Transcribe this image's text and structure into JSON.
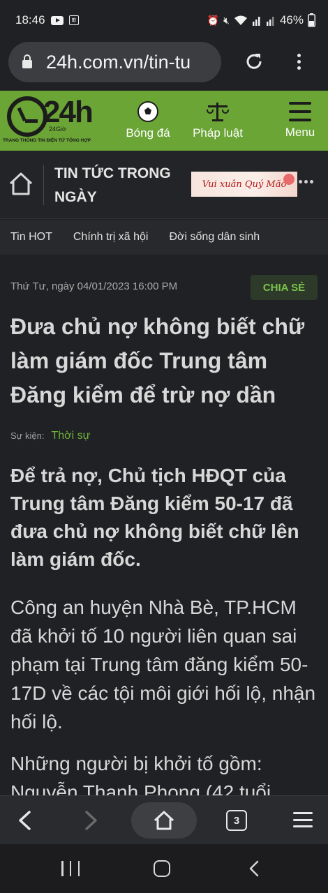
{
  "status_bar": {
    "time": "18:46",
    "battery": "46%",
    "icons": [
      "youtube-icon",
      "sim-icon",
      "alarm-icon",
      "mute-icon",
      "wifi-icon",
      "signal-icon",
      "signal-icon",
      "battery-icon"
    ]
  },
  "browser": {
    "url": "24h.com.vn/tin-tu",
    "icons": [
      "lock-icon",
      "reload-icon",
      "more-vert-icon"
    ]
  },
  "site_header": {
    "logo_text": "24h",
    "logo_sub": "24Giờ",
    "logo_tagline": "TRANG THÔNG TIN ĐIỆN TỬ TỔNG HỢP",
    "nav": [
      {
        "label": "Bóng đá",
        "icon": "soccer-ball-icon"
      },
      {
        "label": "Pháp luật",
        "icon": "scales-icon"
      },
      {
        "label": "Menu",
        "icon": "hamburger-icon"
      }
    ],
    "brand_color": "#6aa535"
  },
  "section_bar": {
    "title": "TIN TỨC TRONG NGÀY",
    "banner_text": "Vui xuân Quý Mão"
  },
  "categories": [
    "Tin HOT",
    "Chính trị xã hội",
    "Đời sống dân sinh"
  ],
  "article": {
    "date": "Thứ Tư, ngày 04/01/2023 16:00 PM",
    "share_label": "CHIA SẺ",
    "headline": "Đưa chủ nợ không biết chữ làm giám đốc Trung tâm Đăng kiểm để trừ nợ dần",
    "event_label": "Sự kiện:",
    "event_link": "Thời sự",
    "lead": "Để trả nợ, Chủ tịch HĐQT của Trung tâm Đăng kiểm 50-17 đã đưa chủ nợ không biết chữ lên làm giám đốc.",
    "paragraph_1": "Công an huyện Nhà Bè, TP.HCM đã khởi tố 10 người liên quan sai phạm tại Trung tâm đăng kiểm 50-17D về các tội môi giới hối lộ, nhận hối lộ.",
    "paragraph_2": "Những người bị khởi tố gồm: Nguyễn Thanh Phong (42 tuổi",
    "accent_color": "#6fb23b"
  },
  "toolbar": {
    "tab_count": "3"
  }
}
